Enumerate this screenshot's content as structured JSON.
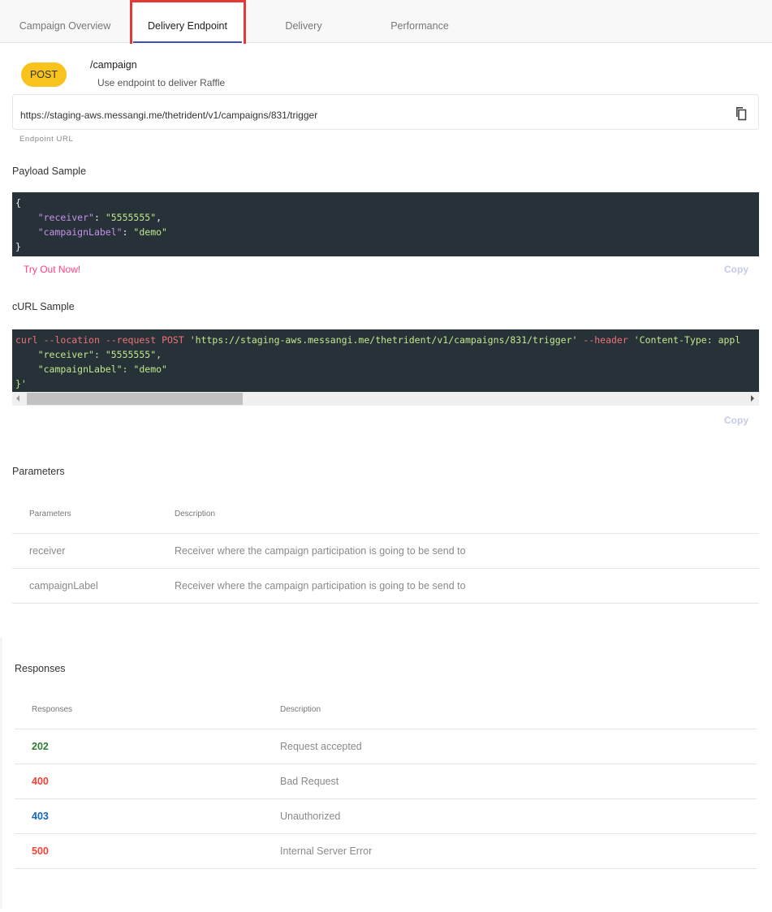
{
  "tabs": [
    {
      "label": "Campaign Overview",
      "active": false
    },
    {
      "label": "Delivery Endpoint",
      "active": true
    },
    {
      "label": "Delivery",
      "active": false
    },
    {
      "label": "Performance",
      "active": false
    }
  ],
  "endpoint": {
    "method": "POST",
    "path": "/campaign",
    "description": "Use endpoint to deliver Raffle",
    "url": "https://staging-aws.messangi.me/thetrident/v1/campaigns/831/trigger",
    "url_label": "Endpoint URL",
    "copy_icon": "copy-icon"
  },
  "payload": {
    "title": "Payload Sample",
    "lines": [
      {
        "open": "{"
      },
      {
        "key": "\"receiver\"",
        "value": "\"5555555\"",
        "trail": ","
      },
      {
        "key": "\"campaignLabel\"",
        "value": "\"demo\"",
        "trail": ""
      },
      {
        "close": "}"
      }
    ],
    "try_label": "Try Out Now!",
    "copy_label": "Copy"
  },
  "curl": {
    "title": "cURL Sample",
    "cmd": "curl",
    "opt_location": "--location",
    "opt_request": "--request",
    "method": "POST",
    "url": "'https://staging-aws.messangi.me/thetrident/v1/campaigns/831/trigger'",
    "opt_header": "--header",
    "header_value": "'Content-Type: appl",
    "body_line1_key": "\"receiver\"",
    "body_line1_value": "\"5555555\",",
    "body_line2_key": "\"campaignLabel\"",
    "body_line2_value": "\"demo\"",
    "close": "}'",
    "copy_label": "Copy",
    "scroll_position": 0
  },
  "parameters": {
    "title": "Parameters",
    "headers": [
      "Parameters",
      "Description"
    ],
    "rows": [
      {
        "name": "receiver",
        "description": "Receiver where the campaign participation is going to be send to"
      },
      {
        "name": "campaignLabel",
        "description": "Receiver where the campaign participation is going to be send to"
      }
    ]
  },
  "responses": {
    "title": "Responses",
    "headers": [
      "Responses",
      "Description"
    ],
    "rows": [
      {
        "code": "202",
        "description": "Request accepted",
        "color": "#2e7d32"
      },
      {
        "code": "400",
        "description": "Bad Request",
        "color": "#f44336"
      },
      {
        "code": "403",
        "description": "Unauthorized",
        "color": "#1565c0"
      },
      {
        "code": "500",
        "description": "Internal Server Error",
        "color": "#f44336"
      }
    ]
  }
}
